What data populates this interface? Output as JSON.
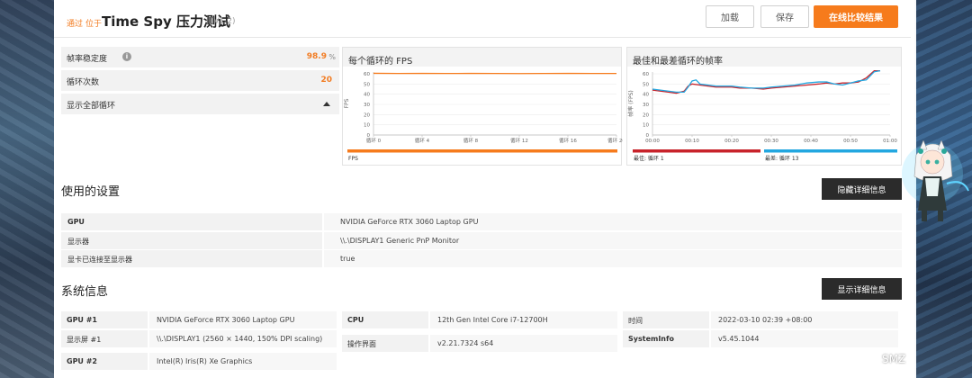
{
  "header": {
    "pass_label": "通过",
    "pass_suffix": "位于",
    "title": "Time Spy 压力测试",
    "version": "(V1.2)",
    "buttons": {
      "load": "加载",
      "save": "保存",
      "compare": "在线比较结果"
    }
  },
  "stats": {
    "stability_label": "帧率稳定度",
    "stability_value": "98.9",
    "stability_unit": "%",
    "loops_label": "循环次数",
    "loops_value": "20",
    "show_all_label": "显示全部循环"
  },
  "colors": {
    "accent": "#f67b1c",
    "link": "#1c9ad6",
    "best": "#c8232b",
    "worst": "#23a7e0",
    "dark_button": "#2b2b2b"
  },
  "chart_data": [
    {
      "type": "line",
      "title": "每个循环的 FPS",
      "ylabel": "FPS",
      "ylim": [
        0,
        60
      ],
      "yticks": [
        "60",
        "50",
        "40",
        "30",
        "20",
        "10",
        "0"
      ],
      "xlim": [
        0,
        20
      ],
      "xticks": [
        "循环 0",
        "循环 4",
        "循环 8",
        "循环 12",
        "循环 16",
        "循环 20"
      ],
      "series": [
        {
          "name": "FPS",
          "x": [
            0,
            2,
            4,
            6,
            8,
            10,
            12,
            14,
            16,
            18,
            20
          ],
          "values": [
            60.5,
            60.3,
            60.4,
            60.3,
            60.4,
            60.3,
            60.2,
            60.3,
            60.4,
            60.3,
            60.3
          ]
        }
      ],
      "legend": [
        "FPS"
      ]
    },
    {
      "type": "line",
      "title": "最佳和最差循环的帧率",
      "ylabel": "帧率 (FPS)",
      "ylim": [
        0,
        60
      ],
      "yticks": [
        "60",
        "50",
        "40",
        "30",
        "20",
        "10",
        "0"
      ],
      "xlim": [
        0,
        60
      ],
      "xticks": [
        "00:00",
        "00:10",
        "00:20",
        "00:30",
        "00:40",
        "00:50",
        "01:00"
      ],
      "series": [
        {
          "name": "最佳: 循环 1",
          "x": [
            0,
            2,
            4,
            6,
            8,
            9,
            10,
            12,
            14,
            16,
            18,
            20,
            22,
            25,
            28,
            30,
            33,
            36,
            39,
            42,
            44,
            46,
            48,
            50,
            52,
            54,
            56,
            57.5
          ],
          "values": [
            44,
            43,
            42,
            41,
            43,
            48,
            50,
            49,
            48,
            47,
            47,
            47,
            46,
            46,
            45,
            46,
            47,
            48,
            49,
            50,
            51,
            50,
            51,
            51,
            52,
            56,
            63,
            63
          ]
        },
        {
          "name": "最差: 循环 13",
          "x": [
            0,
            2,
            4,
            6,
            8,
            9,
            10,
            11,
            12,
            14,
            16,
            18,
            20,
            22,
            25,
            28,
            30,
            33,
            36,
            39,
            42,
            44,
            46,
            48,
            50,
            52,
            54,
            56,
            57.5
          ],
          "values": [
            45,
            44,
            43,
            42,
            42,
            47,
            53,
            54,
            50,
            49,
            48,
            48,
            48,
            47,
            46,
            46,
            47,
            48,
            49,
            51,
            52,
            52,
            50,
            49,
            51,
            53,
            54,
            62,
            63
          ]
        }
      ],
      "legend": [
        "最佳: 循环 1",
        "最差: 循环 13"
      ]
    }
  ],
  "settings": {
    "title": "使用的设置",
    "toggle_label": "隐藏详细信息",
    "rows": [
      {
        "key": "GPU",
        "value": "NVIDIA GeForce RTX 3060 Laptop GPU"
      },
      {
        "key": "显示器",
        "value": "\\\\.\\DISPLAY1 Generic PnP Monitor"
      },
      {
        "key": "显卡已连接至显示器",
        "value": "true"
      }
    ]
  },
  "system": {
    "title": "系统信息",
    "toggle_label": "显示详细信息",
    "col1": [
      {
        "key": "GPU #1",
        "value": "NVIDIA GeForce RTX 3060 Laptop GPU"
      },
      {
        "key": "显示屏 #1",
        "value": "\\\\.\\DISPLAY1 (2560 × 1440, 150% DPI scaling)"
      },
      {
        "key": "GPU #2",
        "value": "Intel(R) Iris(R) Xe Graphics"
      }
    ],
    "col2": [
      {
        "key": "CPU",
        "value": "12th Gen Intel Core i7-12700H"
      },
      {
        "key": "操作界面",
        "value": "v2.21.7324 s64"
      }
    ],
    "col3": [
      {
        "key": "时间",
        "value": "2022-03-10 02:39 +08:00"
      },
      {
        "key": "SystemInfo",
        "value": "v5.45.1044"
      }
    ]
  },
  "watermark": "SMZ"
}
